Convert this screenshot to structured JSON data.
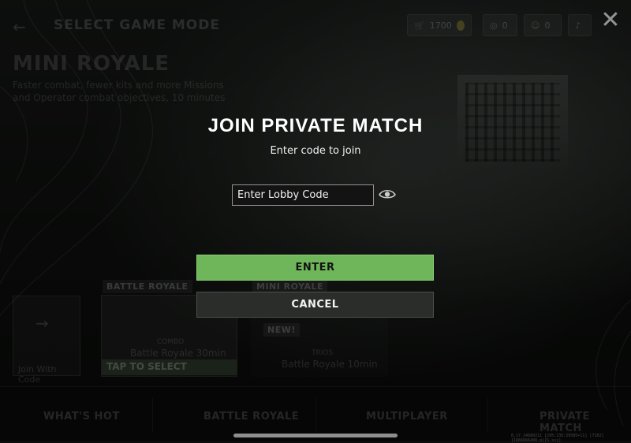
{
  "background": {
    "header": {
      "back_arrow": "←",
      "title": "SELECT GAME MODE"
    },
    "mode": {
      "title": "MINI ROYALE",
      "description": "Faster combat, fewer kits and more Missions and Operator combat objectives, 10 minutes"
    },
    "top_bar": {
      "currency_value": "1700",
      "headset_value": "0",
      "party_value": "0"
    },
    "cards": {
      "join_with_code": "Join With Code",
      "card1_tag": "BATTLE ROYALE",
      "card1_subtitle": "COMBO",
      "card1_name": "Battle Royale 30min",
      "card1_tap": "TAP TO SELECT",
      "card2_tag": "MINI ROYALE",
      "card2_new": "NEW!",
      "card2_subtitle": "TRIOS",
      "card2_name": "Battle Royale 10min"
    },
    "nav": {
      "tabs": [
        "WHAT'S HOT",
        "BATTLE ROYALE",
        "MULTIPLAYER",
        "PRIVATE MATCH"
      ]
    },
    "build_string": "8.17.14680211 [295:235:29585+11] [7102][1666666408.p][S.ssj]"
  },
  "modal": {
    "title": "JOIN PRIVATE MATCH",
    "subtitle": "Enter code to join",
    "code_placeholder": "Enter Lobby Code",
    "enter_label": "ENTER",
    "cancel_label": "CANCEL",
    "close_label": "✕"
  },
  "colors": {
    "enter_button": "#6fb65a",
    "cancel_button": "#2b2d2b"
  }
}
